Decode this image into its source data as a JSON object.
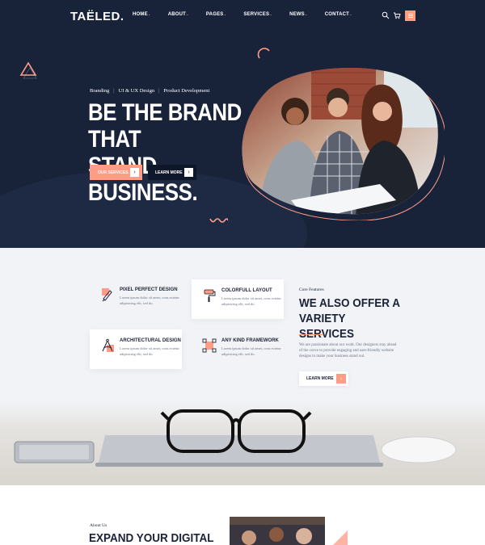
{
  "header": {
    "logo": "TAËLED.",
    "nav": [
      {
        "label": "HOME",
        "has_dropdown": true
      },
      {
        "label": "ABOUT",
        "has_dropdown": true
      },
      {
        "label": "PAGES",
        "has_dropdown": true
      },
      {
        "label": "SERVICES",
        "has_dropdown": true
      },
      {
        "label": "NEWS",
        "has_dropdown": true
      },
      {
        "label": "CONTACT",
        "has_dropdown": true
      }
    ],
    "icons": [
      "search-icon",
      "cart-icon",
      "menu-icon"
    ]
  },
  "hero": {
    "tags": [
      "Branding",
      "UI & UX Design",
      "Product Development"
    ],
    "title_line1": "BE THE BRAND THAT",
    "title_line2": "STAND BUSINESS.",
    "primary_button": "OUR SERVICES",
    "secondary_button": "LEARN MORE"
  },
  "services": {
    "cards": [
      {
        "title": "PIXEL PERFECT DESIGN",
        "desc": "Lorem ipsum dolor sit amet, cons ectetur adipisicing elit, sed do.",
        "icon": "pen-tool-icon"
      },
      {
        "title": "COLORFULL LAYOUT",
        "desc": "Lorem ipsum dolor sit amet, cons ectetur adipisicing elit, sed do.",
        "icon": "paint-roller-icon"
      },
      {
        "title": "ARCHITECTURAL DESIGN",
        "desc": "Lorem ipsum dolor sit amet, cons ectetur adipisicing elit, sed do.",
        "icon": "compass-icon"
      },
      {
        "title": "ANY KIND FRAMEWORK",
        "desc": "Lorem ipsum dolor sit amet, cons ectetur adipisicing elit, sed do.",
        "icon": "vector-nodes-icon"
      }
    ],
    "kicker": "Core Features",
    "title_line1": "WE ALSO OFFER A",
    "title_line2": "VARIETY SERVICES",
    "desc": "We are passionate about our work. Our designers stay ahead of the curve to provide engaging and user-friendly website designs to make your business stand out.",
    "button": "LEARN MORE"
  },
  "about": {
    "kicker": "About Us",
    "title": "EXPAND YOUR DIGITAL"
  },
  "colors": {
    "navy": "#18233a",
    "accent": "#ff9c85",
    "light_bg": "#f1f3f6"
  }
}
